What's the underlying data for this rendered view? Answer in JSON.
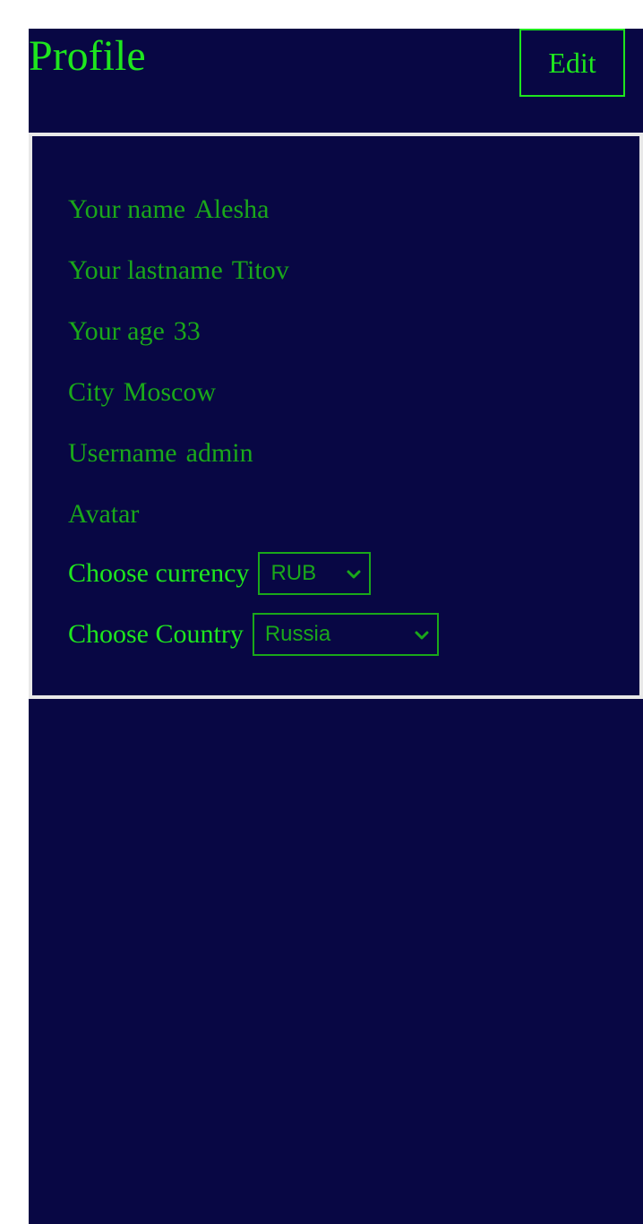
{
  "header": {
    "title": "Profile",
    "edit_label": "Edit"
  },
  "profile": {
    "fields": [
      {
        "label": "Your name",
        "value": "Alesha"
      },
      {
        "label": "Your lastname",
        "value": "Titov"
      },
      {
        "label": "Your age",
        "value": "33"
      },
      {
        "label": "City",
        "value": "Moscow"
      },
      {
        "label": "Username",
        "value": "admin"
      },
      {
        "label": "Avatar",
        "value": ""
      }
    ],
    "currency": {
      "label": "Choose currency",
      "selected": "RUB"
    },
    "country": {
      "label": "Choose Country",
      "selected": "Russia"
    }
  },
  "colors": {
    "background": "#080744",
    "accent": "#1ee61e",
    "text": "#1aa81a",
    "card_border": "#e8e8e8"
  },
  "icons": {
    "dropdown": "chevron-down-icon"
  }
}
